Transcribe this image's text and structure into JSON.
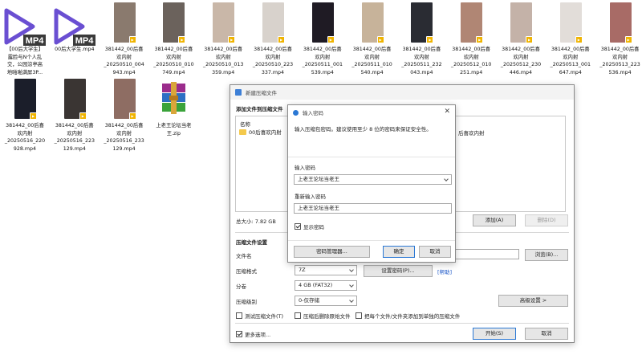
{
  "desktop": {
    "row1": [
      {
        "type": "mp4",
        "label": "【00后大学生】\n露脸与N个人乱\n交，公园涼亭高\n地啪啪满屏3P..."
      },
      {
        "type": "mp4",
        "label": "00后大学生.mp4"
      },
      {
        "type": "thumb",
        "color": "#8a7a6e",
        "label": "381442_00后喜\n欢内射\n_20250510_004\n943.mp4"
      },
      {
        "type": "thumb",
        "color": "#6b625c",
        "label": "381442_00后喜\n欢内射\n_20250510_010\n749.mp4"
      },
      {
        "type": "thumb",
        "color": "#c9b7a8",
        "label": "381442_00后喜\n欢内射\n_20250510_013\n359.mp4"
      },
      {
        "type": "thumb",
        "color": "#d8d2cc",
        "label": "381442_00后喜\n欢内射\n_20250510_223\n337.mp4"
      },
      {
        "type": "thumb",
        "color": "#1f1b24",
        "label": "381442_00后喜\n欢内射\n_20250511_001\n539.mp4"
      },
      {
        "type": "thumb",
        "color": "#c7b39a",
        "label": "381442_00后喜\n欢内射\n_20250511_010\n540.mp4"
      },
      {
        "type": "thumb",
        "color": "#2a2c33",
        "label": "381442_00后喜\n欢内射\n_20250511_232\n043.mp4"
      },
      {
        "type": "thumb",
        "color": "#b08674",
        "label": "381442_00后喜\n欢内射\n_20250512_010\n251.mp4"
      },
      {
        "type": "thumb",
        "color": "#c4b2a8",
        "label": "381442_00后喜\n欢内射\n_20250512_230\n446.mp4"
      },
      {
        "type": "thumb",
        "color": "#e2ddd9",
        "label": "381442_00后喜\n欢内射\n_20250513_001\n647.mp4"
      },
      {
        "type": "thumb",
        "color": "#a86b66",
        "label": "381442_00后喜\n欢内射\n_20250513_223\n536.mp4"
      }
    ],
    "row2": [
      {
        "type": "thumb",
        "color": "#1b1e2a",
        "label": "381442_00后喜\n欢内射\n_20250516_220\n928.mp4"
      },
      {
        "type": "thumb",
        "color": "#3a3533",
        "label": "381442_00后喜\n欢内射\n_20250516_223\n129.mp4"
      },
      {
        "type": "thumb",
        "color": "#8e6d63",
        "label": "381442_00后喜\n欢内射\n_20250516_233\n129.mp4"
      },
      {
        "type": "zip",
        "label": "上老王论坛当老\n王.zip"
      }
    ],
    "mp4_badge": "MP4"
  },
  "main": {
    "title": "新建压缩文件",
    "add_section": "添加文件到压缩文件",
    "col_name": "名称",
    "list_item": "00后喜欢内射",
    "list_item_right": "后喜欢内射",
    "total_size": "总大小: 7.82 GB",
    "add_btn": "添加(A)",
    "delete_btn": "删除(D)",
    "settings_section": "压缩文件设置",
    "filename_label": "文件名",
    "browse_btn": "浏览(B)...",
    "format_label": "压缩格式",
    "format_value": "7Z",
    "set_password_btn": "设置密码(P)...",
    "help_link": "[帮助]",
    "split_label": "分卷",
    "split_value": "4 GB (FAT32)",
    "level_label": "压缩级别",
    "level_value": "0-仅存储",
    "advanced_btn": "高级设置 >",
    "opt_test": "测试压缩文件(T)",
    "opt_delete": "压缩后删除原始文件",
    "opt_separate": "把每个文件/文件夹添加到单独的压缩文件",
    "more_options": "更多选项...",
    "start_btn": "开始(S)",
    "cancel_btn": "取消"
  },
  "pwd": {
    "title": "输入密码",
    "desc": "输入压缩包密码。建议使用至少 8 位的密码来保证安全性。",
    "enter_label": "输入密码",
    "enter_value": "上老王论坛当老王",
    "reenter_label": "重新输入密码",
    "reenter_value": "上老王论坛当老王",
    "show_password": "显示密码",
    "manager_btn": "密码管理器...",
    "ok_btn": "确定",
    "cancel_btn": "取消"
  }
}
